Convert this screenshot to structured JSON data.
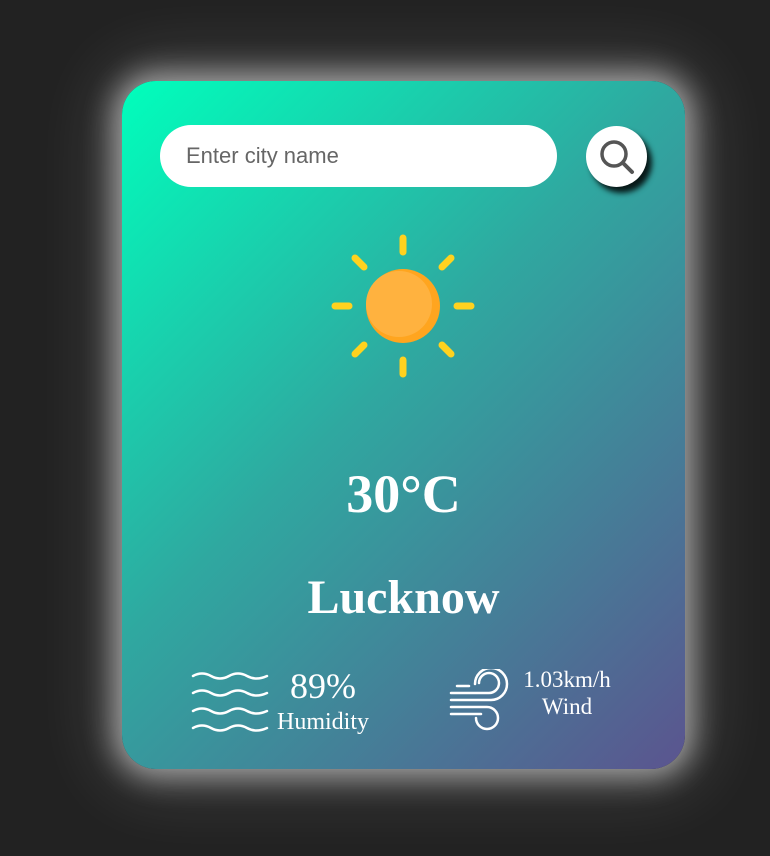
{
  "search": {
    "placeholder": "Enter city name",
    "value": "",
    "button_icon": "search-icon"
  },
  "weather": {
    "icon": "sun-icon",
    "temperature": "30°C",
    "city": "Lucknow"
  },
  "details": {
    "humidity": {
      "icon": "humidity-waves-icon",
      "value": "89%",
      "label": "Humidity"
    },
    "wind": {
      "icon": "wind-icon",
      "value": "1.03km/h",
      "label": "Wind"
    }
  },
  "colors": {
    "gradient_start": "#00ffbc",
    "gradient_end": "#5b548f",
    "sun_core": "#ffb13b",
    "sun_rays": "#ffd21f",
    "text": "#ffffff"
  }
}
